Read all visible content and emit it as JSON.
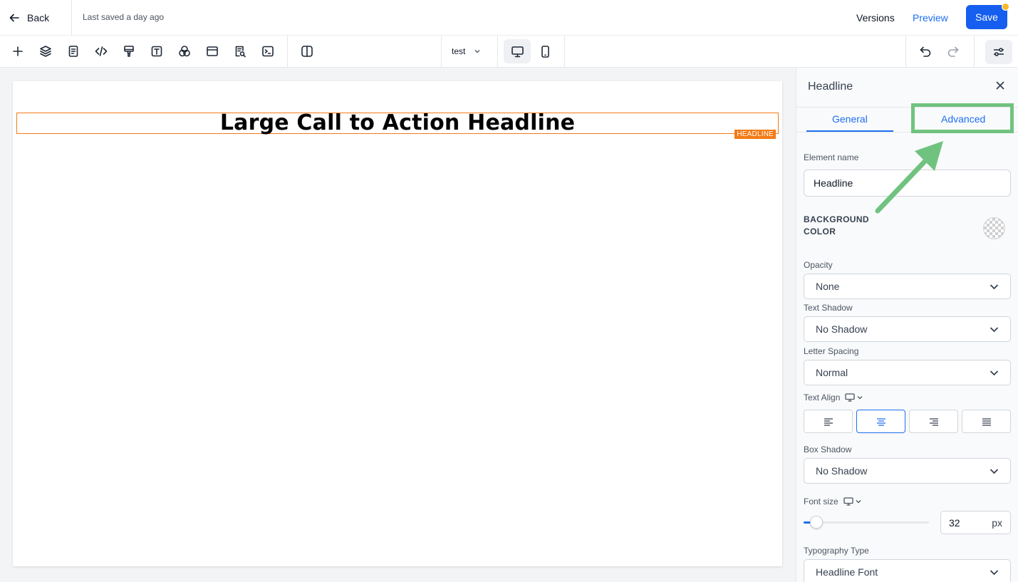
{
  "header": {
    "back_label": "Back",
    "last_saved": "Last saved a day ago",
    "versions_label": "Versions",
    "preview_label": "Preview",
    "save_label": "Save"
  },
  "toolbar": {
    "tools": [
      "plus-icon",
      "layers-icon",
      "page-icon",
      "code-icon",
      "paint-roller-icon",
      "text-icon",
      "color-circles-icon",
      "browser-window-icon",
      "search-doc-icon",
      "terminal-icon",
      "split-columns-icon"
    ],
    "page_select": "test",
    "devices": [
      "desktop-icon",
      "mobile-icon"
    ],
    "active_device": "desktop",
    "undo": "undo-icon",
    "redo": "redo-icon",
    "settings": "sliders-icon"
  },
  "canvas": {
    "headline": "Large Call to Action Headline",
    "tag": "HEADLINE"
  },
  "panel": {
    "title": "Headline",
    "tabs": [
      "General",
      "Advanced"
    ],
    "active_tab": "General",
    "element_name_label": "Element name",
    "element_name_value": "Headline",
    "background_color_label": "BACKGROUND COLOR",
    "opacity_label": "Opacity",
    "opacity_value": "None",
    "text_shadow_label": "Text Shadow",
    "text_shadow_value": "No Shadow",
    "letter_spacing_label": "Letter Spacing",
    "letter_spacing_value": "Normal",
    "text_align_label": "Text Align",
    "text_align_options": [
      "left",
      "center",
      "right",
      "justify"
    ],
    "text_align_active": "center",
    "box_shadow_label": "Box Shadow",
    "box_shadow_value": "No Shadow",
    "font_size_label": "Font size",
    "font_size_value": "32",
    "font_size_unit": "px",
    "font_size_level": 0.1,
    "typography_label": "Typography Type",
    "typography_value": "Headline Font"
  },
  "colors": {
    "accent": "#1d6ff2",
    "save_button": "#155eef",
    "selection": "#f47a15",
    "annotation": "#70c37f",
    "unsaved_dot": "#f9b92a"
  }
}
